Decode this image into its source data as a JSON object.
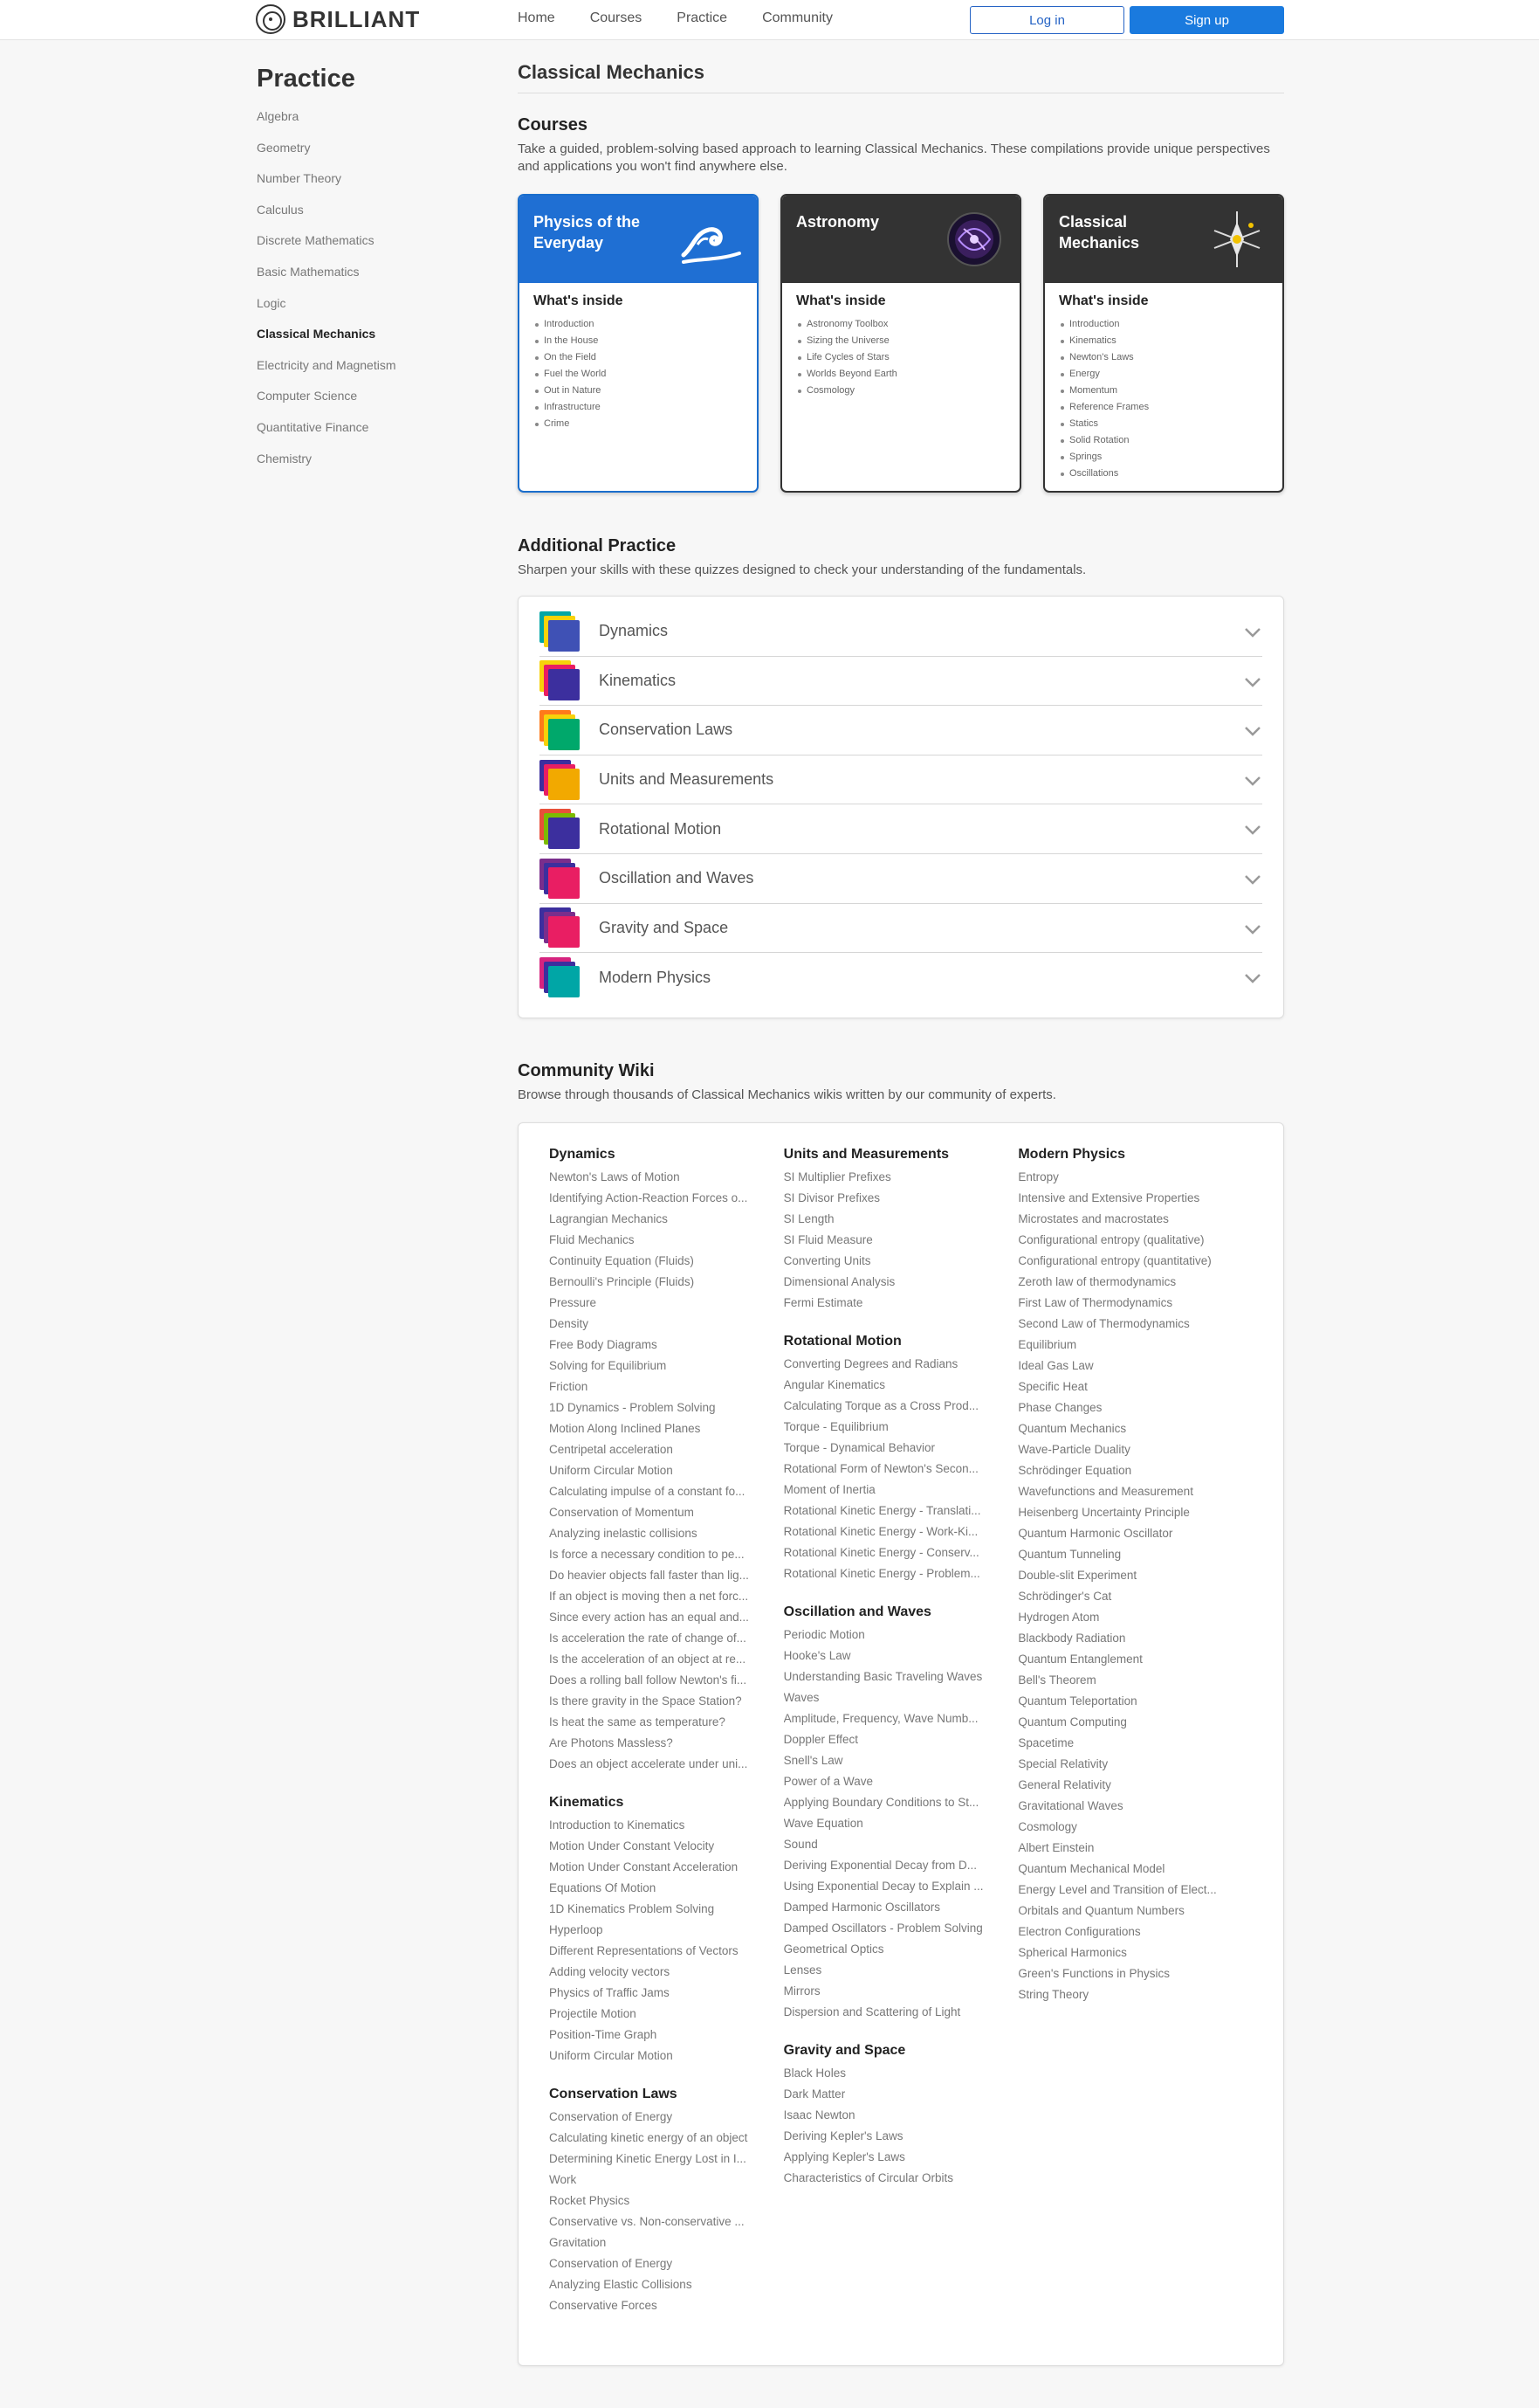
{
  "header": {
    "brand": "BRILLIANT",
    "nav": [
      "Home",
      "Courses",
      "Practice",
      "Community"
    ],
    "login": "Log in",
    "signup": "Sign up"
  },
  "sidebar": {
    "title": "Practice",
    "items": [
      {
        "label": "Algebra",
        "active": false
      },
      {
        "label": "Geometry",
        "active": false
      },
      {
        "label": "Number Theory",
        "active": false
      },
      {
        "label": "Calculus",
        "active": false
      },
      {
        "label": "Discrete Mathematics",
        "active": false
      },
      {
        "label": "Basic Mathematics",
        "active": false
      },
      {
        "label": "Logic",
        "active": false
      },
      {
        "label": "Classical Mechanics",
        "active": true
      },
      {
        "label": "Electricity and Magnetism",
        "active": false
      },
      {
        "label": "Computer Science",
        "active": false
      },
      {
        "label": "Quantitative Finance",
        "active": false
      },
      {
        "label": "Chemistry",
        "active": false
      }
    ]
  },
  "main": {
    "title": "Classical Mechanics",
    "courses": {
      "title": "Courses",
      "desc": "Take a guided, problem-solving based approach to learning Classical Mechanics. These compilations provide unique perspectives and applications you won't find anywhere else.",
      "inside_label": "What's inside",
      "cards": [
        {
          "title": "Physics of the Everyday",
          "icon": "wave-icon",
          "items": [
            "Introduction",
            "In the House",
            "On the Field",
            "Fuel the World",
            "Out in Nature",
            "Infrastructure",
            "Crime"
          ]
        },
        {
          "title": "Astronomy",
          "icon": "galaxy-icon",
          "items": [
            "Astronomy Toolbox",
            "Sizing the Universe",
            "Life Cycles of Stars",
            "Worlds Beyond Earth",
            "Cosmology"
          ]
        },
        {
          "title": "Classical Mechanics",
          "icon": "pendulum-icon",
          "items": [
            "Introduction",
            "Kinematics",
            "Newton's Laws",
            "Energy",
            "Momentum",
            "Reference Frames",
            "Statics",
            "Solid Rotation",
            "Springs",
            "Oscillations"
          ]
        }
      ]
    },
    "additional": {
      "title": "Additional Practice",
      "desc": "Sharpen your skills with these quizzes designed to check your understanding of the fundamentals.",
      "items": [
        {
          "label": "Dynamics",
          "colors": [
            "#3f51b5",
            "#f7d20a",
            "#00a6a6"
          ]
        },
        {
          "label": "Kinematics",
          "colors": [
            "#3c2f9e",
            "#e91e63",
            "#f7d20a"
          ]
        },
        {
          "label": "Conservation Laws",
          "colors": [
            "#00a86b",
            "#f7d20a",
            "#ff7a1a"
          ]
        },
        {
          "label": "Units and Measurements",
          "colors": [
            "#f2a900",
            "#e91e63",
            "#3c2f9e"
          ]
        },
        {
          "label": "Rotational Motion",
          "colors": [
            "#3c2f9e",
            "#7cbb00",
            "#e8503a"
          ]
        },
        {
          "label": "Oscillation and Waves",
          "colors": [
            "#e91e63",
            "#3c2f9e",
            "#7a2e8c"
          ]
        },
        {
          "label": "Gravity and Space",
          "colors": [
            "#e91e63",
            "#7a2e8c",
            "#3c2f9e"
          ]
        },
        {
          "label": "Modern Physics",
          "colors": [
            "#00a6a6",
            "#3c2f9e",
            "#d6247f"
          ]
        }
      ]
    },
    "wiki": {
      "title": "Community Wiki",
      "desc": "Browse through thousands of Classical Mechanics wikis written by our community of experts.",
      "columns": [
        [
          {
            "title": "Dynamics",
            "links": [
              "Newton's Laws of Motion",
              "Identifying Action-Reaction Forces o...",
              "Lagrangian Mechanics",
              "Fluid Mechanics",
              "Continuity Equation (Fluids)",
              "Bernoulli's Principle (Fluids)",
              "Pressure",
              "Density",
              "Free Body Diagrams",
              "Solving for Equilibrium",
              "Friction",
              "1D Dynamics - Problem Solving",
              "Motion Along Inclined Planes",
              "Centripetal acceleration",
              "Uniform Circular Motion",
              "Calculating impulse of a constant fo...",
              "Conservation of Momentum",
              "Analyzing inelastic collisions",
              "Is force a necessary condition to pe...",
              "Do heavier objects fall faster than lig...",
              "If an object is moving then a net forc...",
              "Since every action has an equal and...",
              "Is acceleration the rate of change of...",
              "Is the acceleration of an object at re...",
              "Does a rolling ball follow Newton's fi...",
              "Is there gravity in the Space Station?",
              "Is heat the same as temperature?",
              "Are Photons Massless?",
              "Does an object accelerate under uni..."
            ]
          },
          {
            "title": "Kinematics",
            "links": [
              "Introduction to Kinematics",
              "Motion Under Constant Velocity",
              "Motion Under Constant Acceleration",
              "Equations Of Motion",
              "1D Kinematics Problem Solving",
              "Hyperloop",
              "Different Representations of Vectors",
              "Adding velocity vectors",
              "Physics of Traffic Jams",
              "Projectile Motion",
              "Position-Time Graph",
              "Uniform Circular Motion"
            ]
          },
          {
            "title": "Conservation Laws",
            "links": [
              "Conservation of Energy",
              "Calculating kinetic energy of an object",
              "Determining Kinetic Energy Lost in I...",
              "Work",
              "Rocket Physics",
              "Conservative vs. Non-conservative ...",
              "Gravitation",
              "Conservation of Energy",
              "Analyzing Elastic Collisions",
              "Conservative Forces"
            ]
          }
        ],
        [
          {
            "title": "Units and Measurements",
            "links": [
              "SI Multiplier Prefixes",
              "SI Divisor Prefixes",
              "SI Length",
              "SI Fluid Measure",
              "Converting Units",
              "Dimensional Analysis",
              "Fermi Estimate"
            ]
          },
          {
            "title": "Rotational Motion",
            "links": [
              "Converting Degrees and Radians",
              "Angular Kinematics",
              "Calculating Torque as a Cross Prod...",
              "Torque - Equilibrium",
              "Torque - Dynamical Behavior",
              "Rotational Form of Newton's Secon...",
              "Moment of Inertia",
              "Rotational Kinetic Energy - Translati...",
              "Rotational Kinetic Energy - Work-Ki...",
              "Rotational Kinetic Energy - Conserv...",
              "Rotational Kinetic Energy - Problem..."
            ]
          },
          {
            "title": "Oscillation and Waves",
            "links": [
              "Periodic Motion",
              "Hooke's Law",
              "Understanding Basic Traveling Waves",
              "Waves",
              "Amplitude, Frequency, Wave Numb...",
              "Doppler Effect",
              "Snell's Law",
              "Power of a Wave",
              "Applying Boundary Conditions to St...",
              "Wave Equation",
              "Sound",
              "Deriving Exponential Decay from D...",
              "Using Exponential Decay to Explain ...",
              "Damped Harmonic Oscillators",
              "Damped Oscillators - Problem Solving",
              "Geometrical Optics",
              "Lenses",
              "Mirrors",
              "Dispersion and Scattering of Light"
            ]
          },
          {
            "title": "Gravity and Space",
            "links": [
              "Black Holes",
              "Dark Matter",
              "Isaac Newton",
              "Deriving Kepler's Laws",
              "Applying Kepler's Laws",
              "Characteristics of Circular Orbits"
            ]
          }
        ],
        [
          {
            "title": "Modern Physics",
            "links": [
              "Entropy",
              "Intensive and Extensive Properties",
              "Microstates and macrostates",
              "Configurational entropy (qualitative)",
              "Configurational entropy (quantitative)",
              "Zeroth law of thermodynamics",
              "First Law of Thermodynamics",
              "Second Law of Thermodynamics",
              "Equilibrium",
              "Ideal Gas Law",
              "Specific Heat",
              "Phase Changes",
              "Quantum Mechanics",
              "Wave-Particle Duality",
              "Schrödinger Equation",
              "Wavefunctions and Measurement",
              "Heisenberg Uncertainty Principle",
              "Quantum Harmonic Oscillator",
              "Quantum Tunneling",
              "Double-slit Experiment",
              "Schrödinger's Cat",
              "Hydrogen Atom",
              "Blackbody Radiation",
              "Quantum Entanglement",
              "Bell's Theorem",
              "Quantum Teleportation",
              "Quantum Computing",
              "Spacetime",
              "Special Relativity",
              "General Relativity",
              "Gravitational Waves",
              "Cosmology",
              "Albert Einstein",
              "Quantum Mechanical Model",
              "Energy Level and Transition of Elect...",
              "Orbitals and Quantum Numbers",
              "Electron Configurations",
              "Spherical Harmonics",
              "Green's Functions in Physics",
              "String Theory"
            ]
          }
        ]
      ]
    }
  }
}
